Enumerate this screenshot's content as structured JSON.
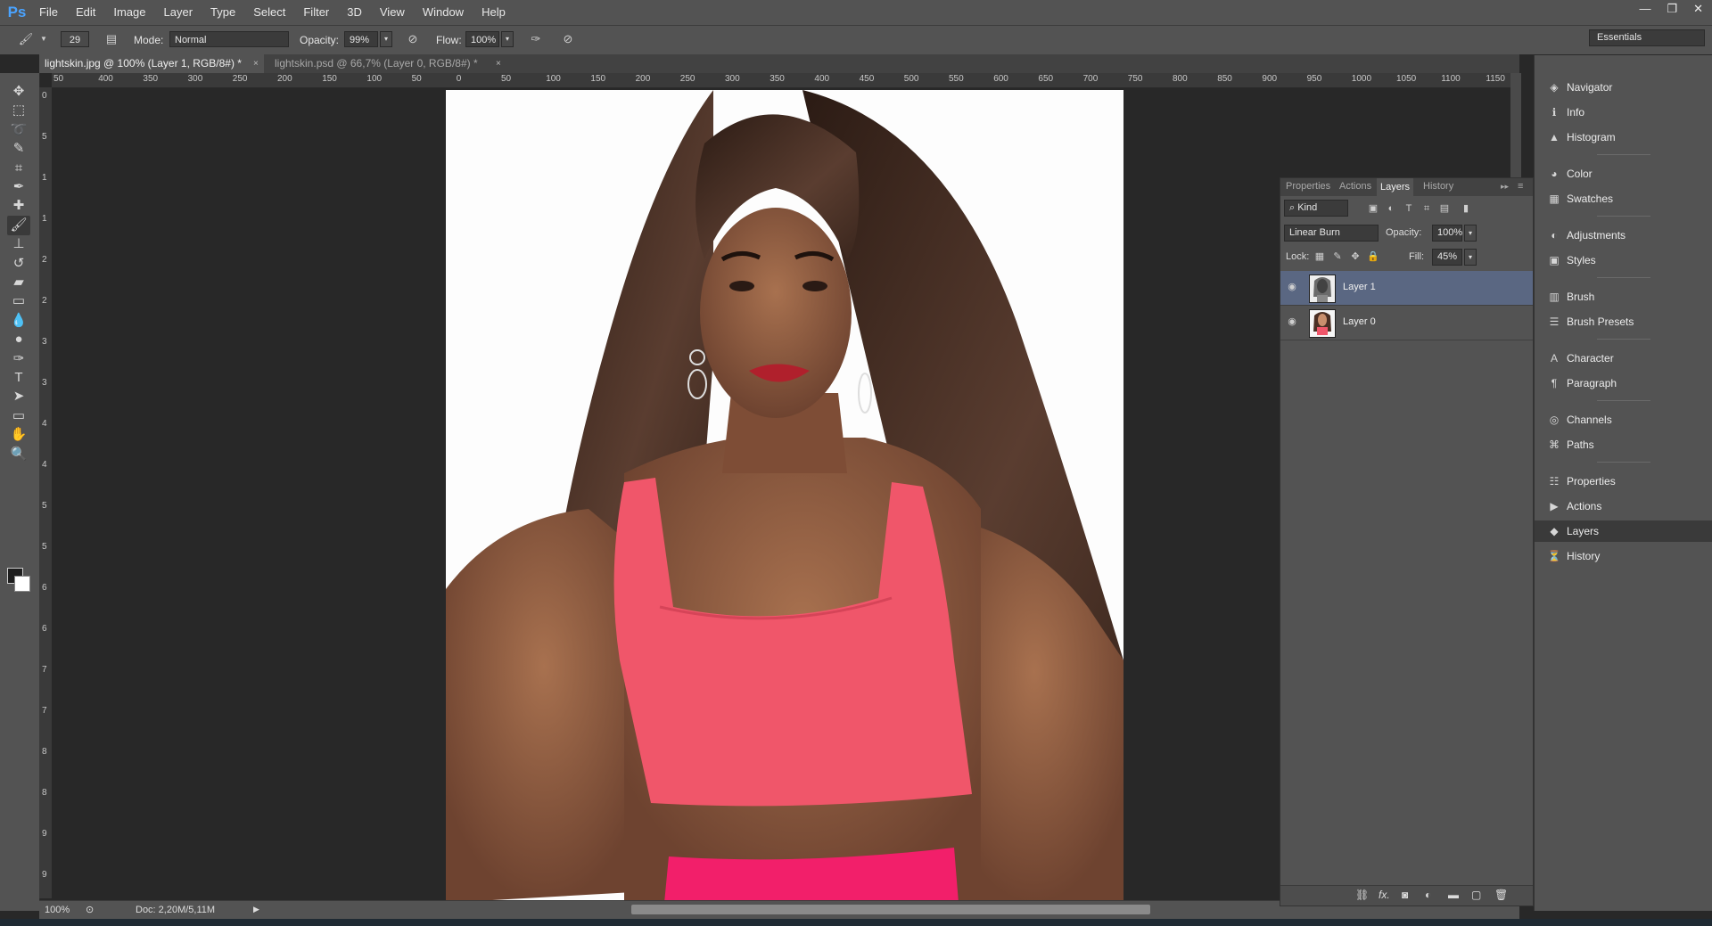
{
  "app": {
    "logo": "Ps"
  },
  "menu": [
    "File",
    "Edit",
    "Image",
    "Layer",
    "Type",
    "Select",
    "Filter",
    "3D",
    "View",
    "Window",
    "Help"
  ],
  "window_controls": {
    "minimize": "—",
    "restore": "❐",
    "close": "✕"
  },
  "options_bar": {
    "brush_size": "29",
    "mode_label": "Mode:",
    "mode_value": "Normal",
    "opacity_label": "Opacity:",
    "opacity_value": "99%",
    "flow_label": "Flow:",
    "flow_value": "100%"
  },
  "workspace": "Essentials",
  "doc_tabs": [
    {
      "title": "lightskin.jpg @ 100% (Layer 1, RGB/8#) *",
      "close": "×"
    },
    {
      "title": "lightskin.psd @ 66,7% (Layer 0, RGB/8#) *",
      "close": "×"
    }
  ],
  "ruler_top": [
    "50",
    "400",
    "350",
    "300",
    "250",
    "200",
    "150",
    "100",
    "50",
    "0",
    "50",
    "100",
    "150",
    "200",
    "250",
    "300",
    "350",
    "400",
    "450",
    "500",
    "550",
    "600",
    "650",
    "700",
    "750",
    "800",
    "850",
    "900",
    "950",
    "1000",
    "1050",
    "1100",
    "1150"
  ],
  "ruler_left": [
    "0",
    "5",
    "1",
    "1",
    "2",
    "2",
    "3",
    "3",
    "4",
    "4",
    "5",
    "5",
    "6",
    "6",
    "7",
    "7",
    "8",
    "8",
    "9",
    "9"
  ],
  "tools": [
    {
      "name": "move-tool-icon",
      "glyph": "✥"
    },
    {
      "name": "marquee-tool-icon",
      "glyph": "⬚"
    },
    {
      "name": "lasso-tool-icon",
      "glyph": "➰"
    },
    {
      "name": "quick-select-tool-icon",
      "glyph": "✎"
    },
    {
      "name": "crop-tool-icon",
      "glyph": "⌗"
    },
    {
      "name": "eyedropper-tool-icon",
      "glyph": "✒"
    },
    {
      "name": "spot-heal-tool-icon",
      "glyph": "✚"
    },
    {
      "name": "brush-tool-icon",
      "glyph": "🖌"
    },
    {
      "name": "clone-stamp-tool-icon",
      "glyph": "⊥"
    },
    {
      "name": "history-brush-tool-icon",
      "glyph": "↺"
    },
    {
      "name": "eraser-tool-icon",
      "glyph": "▰"
    },
    {
      "name": "gradient-tool-icon",
      "glyph": "▭"
    },
    {
      "name": "blur-tool-icon",
      "glyph": "💧"
    },
    {
      "name": "dodge-tool-icon",
      "glyph": "●"
    },
    {
      "name": "pen-tool-icon",
      "glyph": "✑"
    },
    {
      "name": "type-tool-icon",
      "glyph": "T"
    },
    {
      "name": "path-select-tool-icon",
      "glyph": "➤"
    },
    {
      "name": "shape-tool-icon",
      "glyph": "▭"
    },
    {
      "name": "hand-tool-icon",
      "glyph": "✋"
    },
    {
      "name": "zoom-tool-icon",
      "glyph": "🔍"
    }
  ],
  "status": {
    "zoom": "100%",
    "doc": "Doc: 2,20M/5,11M"
  },
  "layers_panel": {
    "tabs": [
      "Properties",
      "Actions",
      "Layers",
      "History"
    ],
    "active_tab": "Layers",
    "filter_kind": "Kind",
    "blend_mode": "Linear Burn",
    "opacity_label": "Opacity:",
    "opacity_value": "100%",
    "lock_label": "Lock:",
    "fill_label": "Fill:",
    "fill_value": "45%",
    "layers": [
      {
        "name": "Layer 1",
        "selected": true
      },
      {
        "name": "Layer 0",
        "selected": false
      }
    ],
    "bottom_icons": [
      "link-icon",
      "fx-icon",
      "mask-icon",
      "adjustment-icon",
      "group-icon",
      "new-layer-icon",
      "trash-icon"
    ],
    "fx_label": "fx."
  },
  "dock": [
    {
      "label": "Navigator",
      "icon": "navigator-icon",
      "glyph": "◈"
    },
    {
      "label": "Info",
      "icon": "info-icon",
      "glyph": "ℹ"
    },
    {
      "label": "Histogram",
      "icon": "histogram-icon",
      "glyph": "▲"
    },
    {
      "label": "Color",
      "icon": "color-icon",
      "glyph": "◕"
    },
    {
      "label": "Swatches",
      "icon": "swatches-icon",
      "glyph": "▦"
    },
    {
      "label": "Adjustments",
      "icon": "adjustments-icon",
      "glyph": "◐"
    },
    {
      "label": "Styles",
      "icon": "styles-icon",
      "glyph": "▣"
    },
    {
      "label": "Brush",
      "icon": "brush-icon",
      "glyph": "▥"
    },
    {
      "label": "Brush Presets",
      "icon": "brush-presets-icon",
      "glyph": "☰"
    },
    {
      "label": "Character",
      "icon": "character-icon",
      "glyph": "A"
    },
    {
      "label": "Paragraph",
      "icon": "paragraph-icon",
      "glyph": "¶"
    },
    {
      "label": "Channels",
      "icon": "channels-icon",
      "glyph": "◎"
    },
    {
      "label": "Paths",
      "icon": "paths-icon",
      "glyph": "⌘"
    },
    {
      "label": "Properties",
      "icon": "properties-icon",
      "glyph": "☷"
    },
    {
      "label": "Actions",
      "icon": "actions-icon",
      "glyph": "▶"
    },
    {
      "label": "Layers",
      "icon": "layers-icon",
      "glyph": "◆",
      "active": true
    },
    {
      "label": "History",
      "icon": "history-icon",
      "glyph": "⏳"
    }
  ],
  "colors": {
    "accent": "#4aa3ff",
    "selected_layer": "#5a6782",
    "shirt": "#f0566a",
    "skin": "#8b5a42",
    "hair": "#3a261d"
  }
}
